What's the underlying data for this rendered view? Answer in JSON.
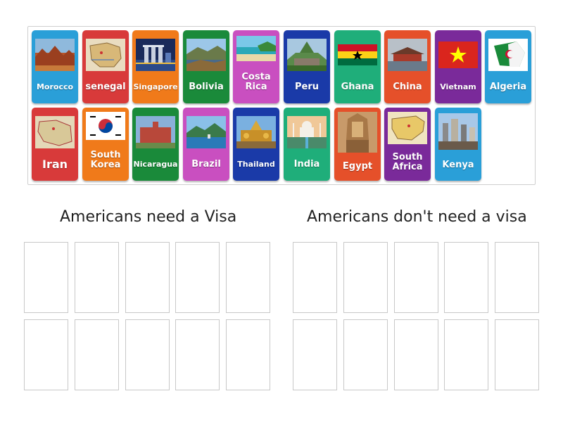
{
  "cards": [
    {
      "label": "Morocco",
      "color": "#2a9fd8",
      "icon": "landscape-photo-icon"
    },
    {
      "label": "senegal",
      "color": "#d83a3a",
      "icon": "map-icon"
    },
    {
      "label": "Singapore",
      "color": "#f07a1a",
      "icon": "city-skyline-photo-icon"
    },
    {
      "label": "Bolivia",
      "color": "#1a8a3a",
      "icon": "landscape-photo-icon"
    },
    {
      "label": "Costa Rica",
      "color": "#c94fc0",
      "icon": "beach-photo-icon"
    },
    {
      "label": "Peru",
      "color": "#1a3aa8",
      "icon": "mountain-ruins-photo-icon"
    },
    {
      "label": "Ghana",
      "color": "#1fae7a",
      "icon": "ghana-flag-icon"
    },
    {
      "label": "China",
      "color": "#e5502a",
      "icon": "palace-photo-icon"
    },
    {
      "label": "Vietnam",
      "color": "#7a2a9a",
      "icon": "vietnam-flag-icon"
    },
    {
      "label": "Algeria",
      "color": "#2a9fd8",
      "icon": "algeria-flag-icon"
    },
    {
      "label": "Iran",
      "color": "#d83a3a",
      "icon": "map-icon"
    },
    {
      "label": "South Korea",
      "color": "#f07a1a",
      "icon": "south-korea-flag-icon"
    },
    {
      "label": "Nicaragua",
      "color": "#1a8a3a",
      "icon": "building-photo-icon"
    },
    {
      "label": "Brazil",
      "color": "#c94fc0",
      "icon": "city-coast-photo-icon"
    },
    {
      "label": "Thailand",
      "color": "#1a3aa8",
      "icon": "temple-statues-photo-icon"
    },
    {
      "label": "India",
      "color": "#1fae7a",
      "icon": "taj-mahal-photo-icon"
    },
    {
      "label": "Egypt",
      "color": "#e5502a",
      "icon": "pharaoh-statue-photo-icon"
    },
    {
      "label": "South Africa",
      "color": "#7a2a9a",
      "icon": "map-icon"
    },
    {
      "label": "Kenya",
      "color": "#2a9fd8",
      "icon": "city-photo-icon"
    }
  ],
  "groups": [
    {
      "title": "Americans need a Visa"
    },
    {
      "title": "Americans don't need a visa"
    }
  ]
}
